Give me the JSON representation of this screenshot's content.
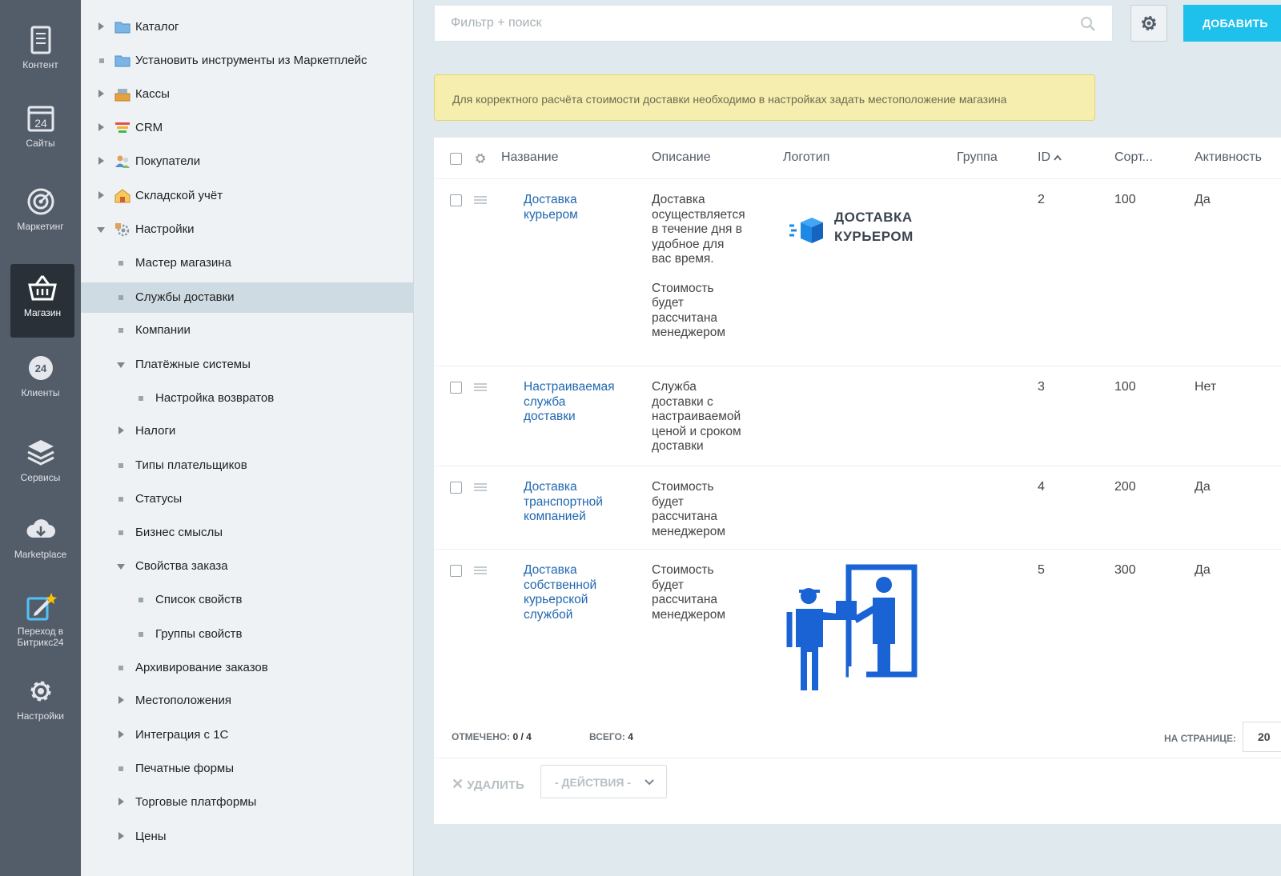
{
  "rail": [
    {
      "label": "Контент",
      "icon": "document-icon"
    },
    {
      "label": "Сайты",
      "icon": "calendar-24-icon"
    },
    {
      "label": "Маркетинг",
      "icon": "target-icon"
    },
    {
      "label": "Магазин",
      "icon": "basket-icon"
    },
    {
      "label": "Клиенты",
      "icon": "clients-24-icon"
    },
    {
      "label": "Сервисы",
      "icon": "layers-icon"
    },
    {
      "label": "Marketplace",
      "icon": "cloud-download-icon"
    },
    {
      "label": "Переход в Битрикс24",
      "icon": "edit-star-icon"
    },
    {
      "label": "Настройки",
      "icon": "gear-icon"
    }
  ],
  "tree": [
    {
      "label": "Каталог"
    },
    {
      "label": "Установить инструменты из Маркетплейс"
    },
    {
      "label": "Кассы"
    },
    {
      "label": "CRM"
    },
    {
      "label": "Покупатели"
    },
    {
      "label": "Складской учёт"
    },
    {
      "label": "Настройки"
    },
    {
      "label": "Мастер магазина"
    },
    {
      "label": "Службы доставки"
    },
    {
      "label": "Компании"
    },
    {
      "label": "Платёжные системы"
    },
    {
      "label": "Настройка возвратов"
    },
    {
      "label": "Налоги"
    },
    {
      "label": "Типы плательщиков"
    },
    {
      "label": "Статусы"
    },
    {
      "label": "Бизнес смыслы"
    },
    {
      "label": "Свойства заказа"
    },
    {
      "label": "Список свойств"
    },
    {
      "label": "Группы свойств"
    },
    {
      "label": "Архивирование заказов"
    },
    {
      "label": "Местоположения"
    },
    {
      "label": "Интеграция с 1С"
    },
    {
      "label": "Печатные формы"
    },
    {
      "label": "Торговые платформы"
    },
    {
      "label": "Цены"
    }
  ],
  "search": {
    "placeholder": "Фильтр + поиск"
  },
  "toolbar": {
    "add_label": "ДОБАВИТЬ"
  },
  "notice": "Для корректного расчёта стоимости доставки необходимо в настройках задать местоположение магазина",
  "columns": {
    "name": "Название",
    "description": "Описание",
    "logo": "Логотип",
    "group": "Группа",
    "id": "ID",
    "sort": "Сорт...",
    "active": "Активность"
  },
  "rows": [
    {
      "name_lines": [
        "Доставка",
        "курьером"
      ],
      "desc_lines": [
        "Доставка",
        "осуществляется",
        "в течение дня в",
        "удобное для",
        "вас время."
      ],
      "desc2_lines": [
        "Стоимость",
        "будет",
        "рассчитана",
        "менеджером"
      ],
      "logo_text_lines": [
        "ДОСТАВКА",
        "КУРЬЕРОМ"
      ],
      "id": "2",
      "sort": "100",
      "active": "Да"
    },
    {
      "name_lines": [
        "Настраиваемая",
        "служба",
        "доставки"
      ],
      "desc_lines": [
        "Служба",
        "доставки с",
        "настраиваемой",
        "ценой и сроком",
        "доставки"
      ],
      "id": "3",
      "sort": "100",
      "active": "Нет"
    },
    {
      "name_lines": [
        "Доставка",
        "транспортной",
        "компанией"
      ],
      "desc_lines": [
        "Стоимость",
        "будет",
        "рассчитана",
        "менеджером"
      ],
      "id": "4",
      "sort": "200",
      "active": "Да"
    },
    {
      "name_lines": [
        "Доставка",
        "собственной",
        "курьерской",
        "службой"
      ],
      "desc_lines": [
        "Стоимость",
        "будет",
        "рассчитана",
        "менеджером"
      ],
      "id": "5",
      "sort": "300",
      "active": "Да"
    }
  ],
  "footer": {
    "selected_label": "ОТМЕЧЕНО:",
    "selected_value": "0 / 4",
    "total_label": "ВСЕГО:",
    "total_value": "4",
    "per_page_label": "НА СТРАНИЦЕ:",
    "per_page_value": "20",
    "delete_label": "УДАЛИТЬ",
    "actions_label": "- ДЕЙСТВИЯ -"
  },
  "colors": {
    "accent": "#1ec0ec",
    "link": "#2067b0",
    "rail": "#535c69",
    "notice": "#f6eeaf"
  }
}
